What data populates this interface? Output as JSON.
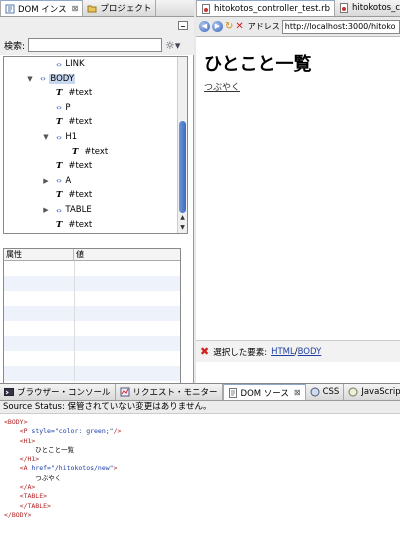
{
  "left_tabs": [
    {
      "label": "DOM インス",
      "active": true,
      "closable": true
    },
    {
      "label": "プロジェクト",
      "active": false,
      "closable": false
    }
  ],
  "search": {
    "label": "検索:",
    "value": ""
  },
  "tree_nodes": [
    {
      "indent": 1,
      "kind": "element",
      "twisty": "",
      "label": "LINK",
      "selected": false
    },
    {
      "indent": 0,
      "kind": "element",
      "twisty": "▼",
      "label": "BODY",
      "selected": true
    },
    {
      "indent": 1,
      "kind": "text",
      "twisty": "",
      "label": "#text",
      "selected": false
    },
    {
      "indent": 1,
      "kind": "element",
      "twisty": "",
      "label": "P",
      "selected": false
    },
    {
      "indent": 1,
      "kind": "text",
      "twisty": "",
      "label": "#text",
      "selected": false
    },
    {
      "indent": 1,
      "kind": "element",
      "twisty": "▼",
      "label": "H1",
      "selected": false
    },
    {
      "indent": 2,
      "kind": "text",
      "twisty": "",
      "label": "#text",
      "selected": false
    },
    {
      "indent": 1,
      "kind": "text",
      "twisty": "",
      "label": "#text",
      "selected": false
    },
    {
      "indent": 1,
      "kind": "element",
      "twisty": "▶",
      "label": "A",
      "selected": false
    },
    {
      "indent": 1,
      "kind": "text",
      "twisty": "",
      "label": "#text",
      "selected": false
    },
    {
      "indent": 1,
      "kind": "element",
      "twisty": "▶",
      "label": "TABLE",
      "selected": false
    },
    {
      "indent": 1,
      "kind": "text",
      "twisty": "",
      "label": "#text",
      "selected": false
    }
  ],
  "attributes": {
    "col_name": "属性",
    "col_value": "値"
  },
  "right_tabs": [
    {
      "label": "hitokotos_controller_test.rb"
    },
    {
      "label": "hitokotos_co"
    }
  ],
  "browser": {
    "address_label": "アドレス",
    "url": "http://localhost:3000/hitoko",
    "heading": "ひとこと一覧",
    "link": "つぶやく",
    "selected_label": "選択した要素:",
    "selected_path": [
      "HTML",
      "BODY"
    ]
  },
  "bottom_tabs": [
    {
      "label": "ブラウザー・コンソール",
      "active": false
    },
    {
      "label": "リクエスト・モニター",
      "active": false
    },
    {
      "label": "DOM ソース",
      "active": true
    },
    {
      "label": "CSS",
      "active": false
    },
    {
      "label": "JavaScript",
      "active": false
    }
  ],
  "source_status": "Source Status:  保管されていない変更はありません。",
  "source_lines": [
    {
      "indent": 0,
      "type": "tag",
      "text": "<BODY>"
    },
    {
      "indent": 1,
      "type": "tagattr",
      "text": "<P ",
      "attr": "style=\"color: green;\"",
      "end": "/>"
    },
    {
      "indent": 1,
      "type": "tag",
      "text": "<H1>"
    },
    {
      "indent": 2,
      "type": "text",
      "text": "ひとこと一覧"
    },
    {
      "indent": 1,
      "type": "tag",
      "text": "</H1>"
    },
    {
      "indent": 1,
      "type": "tagattr",
      "text": "<A ",
      "attr": "href=\"/hitokotos/new\"",
      "end": ">"
    },
    {
      "indent": 2,
      "type": "text",
      "text": "つぶやく"
    },
    {
      "indent": 1,
      "type": "tag",
      "text": "</A>"
    },
    {
      "indent": 1,
      "type": "tag",
      "text": "<TABLE>"
    },
    {
      "indent": 1,
      "type": "tag",
      "text": "</TABLE>"
    },
    {
      "indent": 0,
      "type": "tag",
      "text": "</BODY>"
    }
  ],
  "colors": {
    "accent": "#3e6cc0",
    "tag": "#b22222",
    "attr": "#1a3ca8"
  }
}
